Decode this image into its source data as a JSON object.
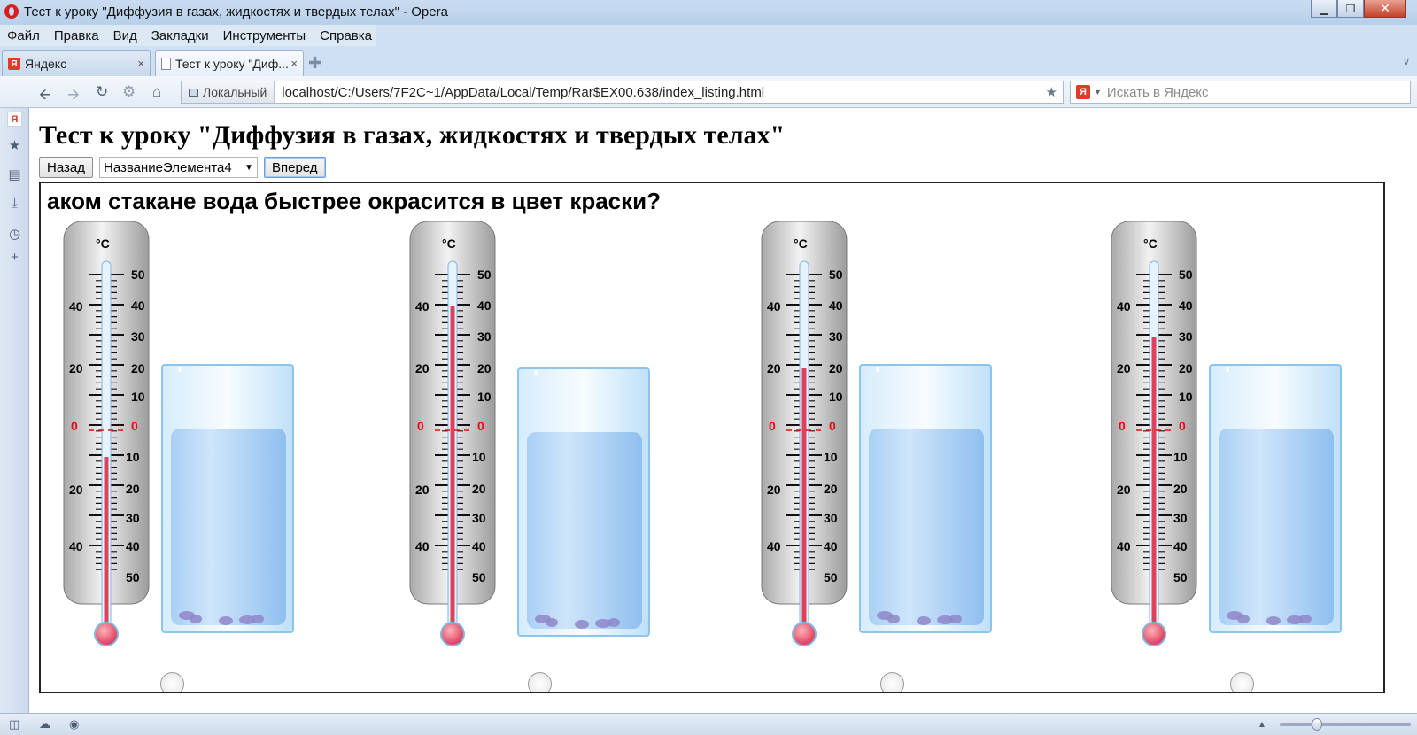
{
  "window": {
    "title": "Тест к уроку \"Диффузия в газах, жидкостях и твердых телах\" - Opera",
    "minimize": "▁",
    "maximize": "❐",
    "close": "✕"
  },
  "menu": [
    "Файл",
    "Правка",
    "Вид",
    "Закладки",
    "Инструменты",
    "Справка"
  ],
  "tabs": [
    {
      "label": "Яндекс",
      "favicon": "yandex-icon",
      "close": "×"
    },
    {
      "label": "Тест к уроку \"Диф...",
      "favicon": "document-icon",
      "close": "×"
    }
  ],
  "new_tab": "✚",
  "tab_menu": "∨",
  "address": {
    "security_label": "Локальный",
    "url": "localhost/C:/Users/7F2C~1/AppData/Local/Temp/Rar$EX00.638/index_listing.html"
  },
  "search": {
    "engine_icon": "Я",
    "placeholder": "Искать в Яндекс"
  },
  "page": {
    "title": "Тест к уроку \"Диффузия в газах, жидкостях и твердых телах\"",
    "back_label": "Назад",
    "select_value": "НазваниеЭлемента4",
    "next_label": "Вперед",
    "question": "аком стакане вода быстрее окрасится в цвет краски?",
    "thermometer_unit": "°С",
    "scale_upper": [
      "50",
      "40",
      "30",
      "20",
      "10",
      "0"
    ],
    "scale_lower": [
      "10",
      "20",
      "30",
      "40",
      "50"
    ],
    "options": [
      {
        "temperature_c": -10
      },
      {
        "temperature_c": 40
      },
      {
        "temperature_c": 20
      },
      {
        "temperature_c": 30
      }
    ]
  },
  "colors": {
    "mercury": "#e0415a",
    "zero_mark": "#e01010",
    "water": "#b5d7f7",
    "glass_edge": "#8cc4ec"
  }
}
